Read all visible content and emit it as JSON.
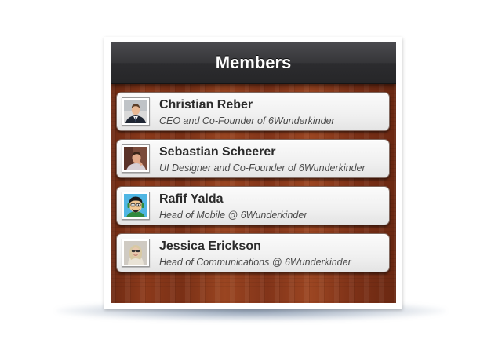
{
  "window": {
    "title": "Members"
  },
  "members": [
    {
      "name": "Christian Reber",
      "role": "CEO and Co-Founder of 6Wunderkinder",
      "avatar_icon": "person-photo-icon"
    },
    {
      "name": "Sebastian Scheerer",
      "role": "UI Designer and Co-Founder of 6Wunderkinder",
      "avatar_icon": "person-photo-icon"
    },
    {
      "name": "Rafif Yalda",
      "role": "Head of Mobile @ 6Wunderkinder",
      "avatar_icon": "cartoon-avatar-icon"
    },
    {
      "name": "Jessica Erickson",
      "role": "Head of Communications @ 6Wunderkinder",
      "avatar_icon": "person-photo-icon"
    }
  ],
  "colors": {
    "titlebar": "#2c2c2f",
    "wood": "#8c3a1b",
    "card": "#f0f0f0",
    "name_text": "#2a2a2a",
    "role_text": "#4a4a4a"
  }
}
